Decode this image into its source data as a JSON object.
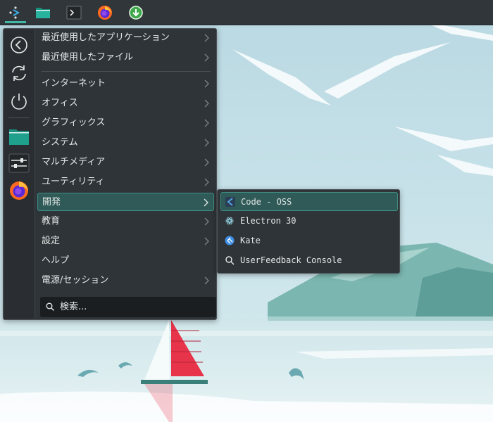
{
  "panel": {
    "items": [
      {
        "name": "application-launcher",
        "icon": "kde-launcher-icon",
        "active": true
      },
      {
        "name": "file-manager",
        "icon": "folder-icon",
        "active": false
      },
      {
        "name": "terminal",
        "icon": "terminal-icon",
        "active": false
      },
      {
        "name": "firefox",
        "icon": "firefox-icon",
        "active": false
      },
      {
        "name": "update-notifier",
        "icon": "download-icon",
        "active": false
      }
    ]
  },
  "launcher": {
    "sidebar": [
      {
        "name": "back",
        "icon": "back-arrow-icon"
      },
      {
        "name": "reboot",
        "icon": "refresh-icon"
      },
      {
        "name": "shutdown",
        "icon": "power-icon"
      },
      {
        "name": "files",
        "icon": "folder-icon"
      },
      {
        "name": "settings",
        "icon": "settings-sliders-icon"
      },
      {
        "name": "firefox",
        "icon": "firefox-icon"
      }
    ],
    "categories": [
      {
        "label": "最近使用したアプリケーション",
        "has_submenu": true
      },
      {
        "label": "最近使用したファイル",
        "has_submenu": true
      },
      {
        "label": "インターネット",
        "has_submenu": true
      },
      {
        "label": "オフィス",
        "has_submenu": true
      },
      {
        "label": "グラフィックス",
        "has_submenu": true
      },
      {
        "label": "システム",
        "has_submenu": true
      },
      {
        "label": "マルチメディア",
        "has_submenu": true
      },
      {
        "label": "ユーティリティ",
        "has_submenu": true
      },
      {
        "label": "開発",
        "has_submenu": true,
        "selected": true
      },
      {
        "label": "教育",
        "has_submenu": true
      },
      {
        "label": "設定",
        "has_submenu": true
      },
      {
        "label": "ヘルプ",
        "has_submenu": false
      },
      {
        "label": "電源/セッション",
        "has_submenu": true
      }
    ],
    "search": {
      "placeholder": "検索..."
    }
  },
  "submenu": {
    "items": [
      {
        "label": "Code - OSS",
        "icon": "vscode-icon",
        "selected": true
      },
      {
        "label": "Electron 30",
        "icon": "electron-icon"
      },
      {
        "label": "Kate",
        "icon": "kate-icon"
      },
      {
        "label": "UserFeedback Console",
        "icon": "search-icon"
      }
    ]
  },
  "colors": {
    "panel": "#31363b",
    "menu_bg": "#2f3438",
    "accent": "#3e8f86",
    "selection": "#2f5a57",
    "sky": "#c9e2ea",
    "sail_red": "#e8344a"
  }
}
